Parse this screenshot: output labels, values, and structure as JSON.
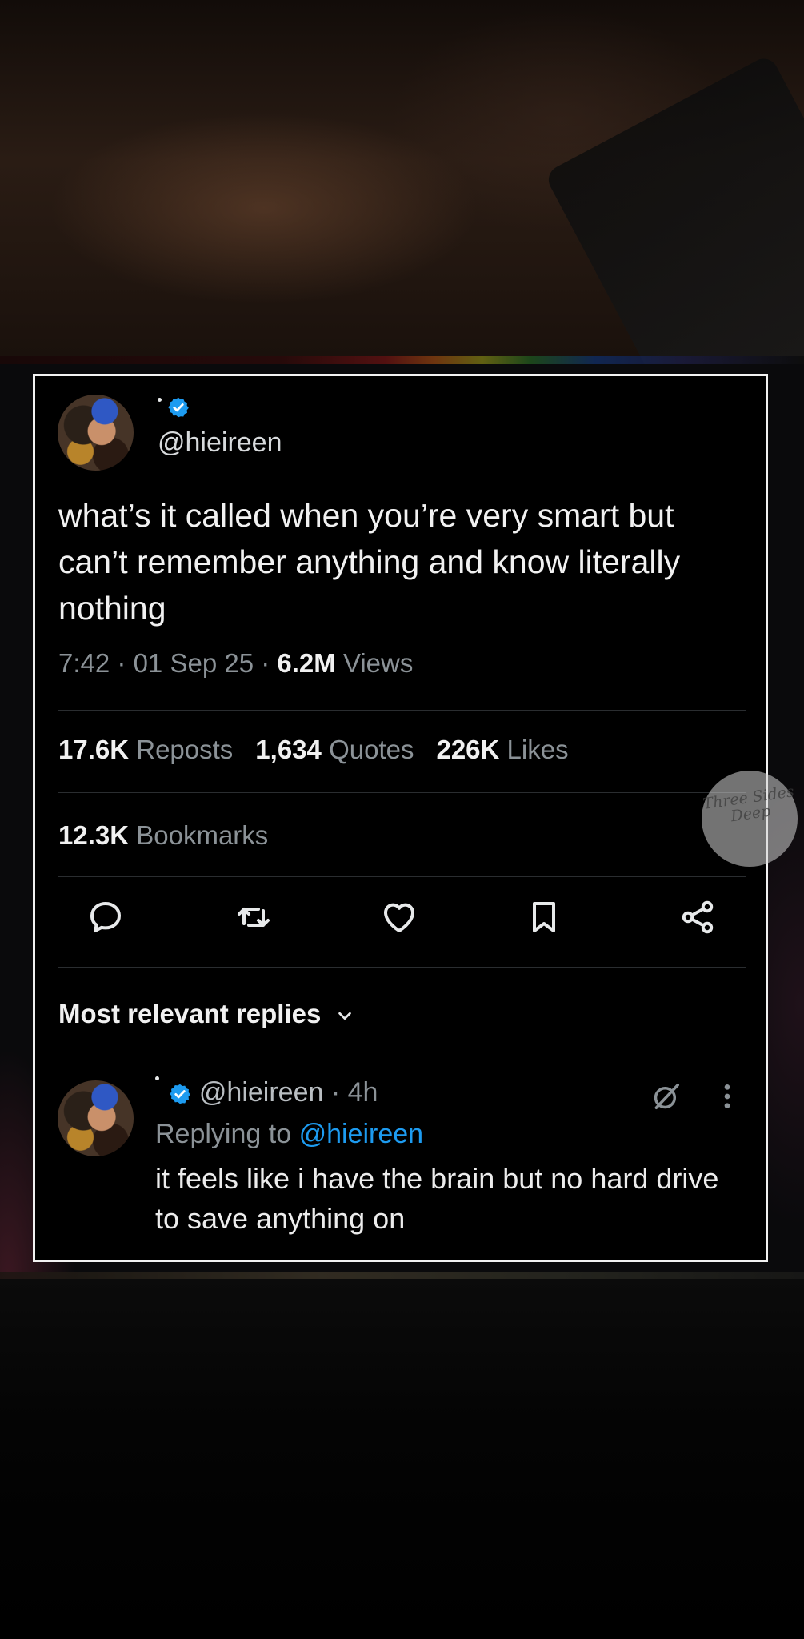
{
  "tweet": {
    "handle": "@hieireen",
    "text": "what’s it called when you’re very smart but can’t remember anything and know literally nothing",
    "time": "7:42",
    "date": "01 Sep 25",
    "views_count": "6.2M",
    "views_label": "Views",
    "stats": {
      "reposts_count": "17.6K",
      "reposts_label": "Reposts",
      "quotes_count": "1,634",
      "quotes_label": "Quotes",
      "likes_count": "226K",
      "likes_label": "Likes",
      "bookmarks_count": "12.3K",
      "bookmarks_label": "Bookmarks"
    },
    "actions": [
      "reply-icon",
      "repost-icon",
      "like-icon",
      "bookmark-icon",
      "share-icon"
    ]
  },
  "replies": {
    "header": "Most relevant replies",
    "items": [
      {
        "handle": "@hieireen",
        "age": "4h",
        "replying_prefix": "Replying to",
        "replying_mention": "@hieireen",
        "text": "it feels like i have the brain but no hard drive to save anything on"
      }
    ]
  },
  "watermark": {
    "text": "Three Sides Deep"
  },
  "colors": {
    "accent": "#1d9bf0",
    "text": "#e7e9ea",
    "muted": "#8b9297",
    "card_border": "#f2f2f2",
    "background": "#000000"
  }
}
